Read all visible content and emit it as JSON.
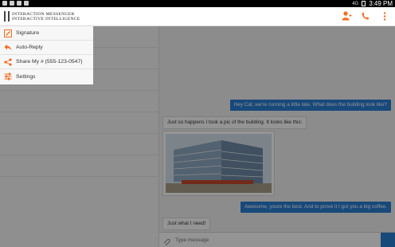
{
  "status_bar": {
    "signal": "4G",
    "time": "3:49 PM"
  },
  "app": {
    "logo_line1": "Interaction Messenger",
    "logo_line2": "Interactive Intelligence",
    "accent": "#f26c21"
  },
  "drawer": {
    "items": [
      {
        "label": "Signature",
        "icon": "signature-icon"
      },
      {
        "label": "Auto-Reply",
        "icon": "reply-icon"
      },
      {
        "label": "Share My # (555-123-0547)",
        "icon": "share-icon"
      },
      {
        "label": "Settings",
        "icon": "settings-sliders-icon"
      }
    ]
  },
  "chat": {
    "messages": [
      {
        "direction": "outgoing",
        "text": "Hey Cat, we're running a little late. What does the building look like?"
      },
      {
        "direction": "incoming",
        "text": "Just so happens I took a pic of the building. It looks like this:"
      },
      {
        "direction": "outgoing",
        "text": "Awesome, youre the best. And to prove it I got you a big coffee."
      },
      {
        "direction": "incoming",
        "text": "Just what I need!"
      }
    ],
    "composer_placeholder": "Type message",
    "bubble_out_color": "#2a7fd4"
  }
}
